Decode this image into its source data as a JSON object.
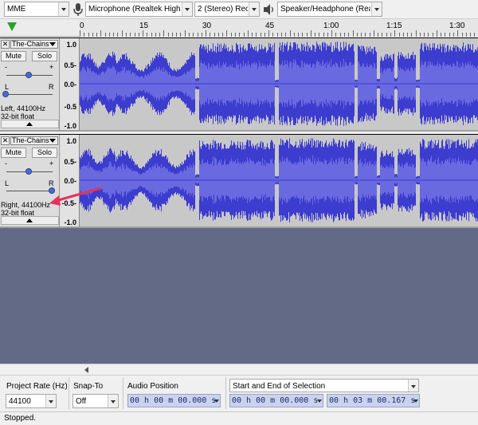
{
  "device_toolbar": {
    "host": "MME",
    "mic_icon": "microphone-icon",
    "recording_device": "Microphone (Realtek High I",
    "channels": "2 (Stereo) Recor",
    "speaker_icon": "speaker-icon",
    "playback_device": "Speaker/Headphone (Realt"
  },
  "ruler": {
    "ticks": [
      "0",
      "15",
      "30",
      "45",
      "1:00",
      "1:15",
      "1:30"
    ]
  },
  "tracks": [
    {
      "name": "The-Chains",
      "mute": "Mute",
      "solo": "Solo",
      "pan_left": "L",
      "pan_right": "R",
      "info_line1": "Left, 44100Hz",
      "info_line2": "32-bit float",
      "scale": [
        "1.0",
        "0.5-",
        "0.0-",
        "-0.5",
        "-1.0"
      ]
    },
    {
      "name": "The-Chains",
      "mute": "Mute",
      "solo": "Solo",
      "pan_left": "L",
      "pan_right": "R",
      "info_line1": "Right, 44100Hz",
      "info_line2": "32-bit float",
      "scale": [
        "1.0",
        "0.5-",
        "0.0-",
        "-0.5-",
        "-1.0"
      ]
    }
  ],
  "selection_toolbar": {
    "project_rate_label": "Project Rate (Hz)",
    "project_rate_value": "44100",
    "snap_to_label": "Snap-To",
    "snap_to_value": "Off",
    "audio_position_label": "Audio Position",
    "audio_position_value": "00 h 00 m 00.000 s",
    "selection_mode": "Start and End of Selection",
    "selection_start": "00 h 00 m 00.000 s",
    "selection_end": "00 h 03 m 00.167 s"
  },
  "status": "Stopped.",
  "colors": {
    "waveform": "#3c3ccf",
    "waveform_light": "#6a6ae0",
    "track_area_bg": "#636a86",
    "annotation_arrow": "#e8325a"
  }
}
